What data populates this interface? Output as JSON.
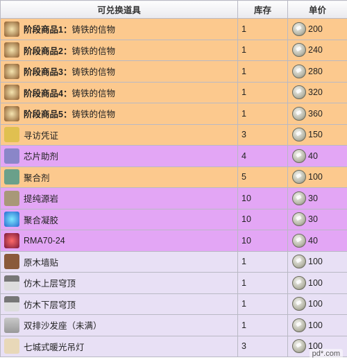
{
  "header": {
    "col_item": "可兑换道具",
    "col_stock": "库存",
    "col_price": "单价"
  },
  "rows": [
    {
      "name": "阶段商品1：铸铁的信物",
      "stock": "1",
      "price": "200",
      "bold_prefix": "阶段商品1：",
      "rest": "铸铁的信物",
      "icon": "stage-gift-icon"
    },
    {
      "name": "阶段商品2：铸铁的信物",
      "stock": "1",
      "price": "240",
      "bold_prefix": "阶段商品2：",
      "rest": "铸铁的信物",
      "icon": "stage-gift-icon"
    },
    {
      "name": "阶段商品3：铸铁的信物",
      "stock": "1",
      "price": "280",
      "bold_prefix": "阶段商品3：",
      "rest": "铸铁的信物",
      "icon": "stage-gift-icon"
    },
    {
      "name": "阶段商品4：铸铁的信物",
      "stock": "1",
      "price": "320",
      "bold_prefix": "阶段商品4：",
      "rest": "铸铁的信物",
      "icon": "stage-gift-icon"
    },
    {
      "name": "阶段商品5：铸铁的信物",
      "stock": "1",
      "price": "360",
      "bold_prefix": "阶段商品5：",
      "rest": "铸铁的信物",
      "icon": "stage-gift-icon"
    },
    {
      "name": "寻访凭证",
      "stock": "3",
      "price": "150",
      "icon": "voucher-icon"
    },
    {
      "name": "芯片助剂",
      "stock": "4",
      "price": "40",
      "icon": "chip-catalyst-icon"
    },
    {
      "name": "聚合剂",
      "stock": "5",
      "price": "100",
      "icon": "polymerizer-icon"
    },
    {
      "name": "提纯源岩",
      "stock": "10",
      "price": "30",
      "icon": "orirock-icon"
    },
    {
      "name": "聚合凝胶",
      "stock": "10",
      "price": "30",
      "icon": "gel-icon"
    },
    {
      "name": "RMA70-24",
      "stock": "10",
      "price": "40",
      "icon": "rma-icon"
    },
    {
      "name": "原木墙贴",
      "stock": "1",
      "price": "100",
      "icon": "wood-wall-icon"
    },
    {
      "name": "仿木上层穹顶",
      "stock": "1",
      "price": "100",
      "icon": "ceiling-icon"
    },
    {
      "name": "仿木下层穹顶",
      "stock": "1",
      "price": "100",
      "icon": "ceiling-icon"
    },
    {
      "name": "双排沙发座（未满）",
      "stock": "1",
      "price": "100",
      "icon": "sofa-icon"
    },
    {
      "name": "七城式暖光吊灯",
      "stock": "3",
      "price": "100",
      "icon": "lamp-icon"
    }
  ],
  "coin_icon": "coin-icon",
  "watermark": "pd*.com"
}
